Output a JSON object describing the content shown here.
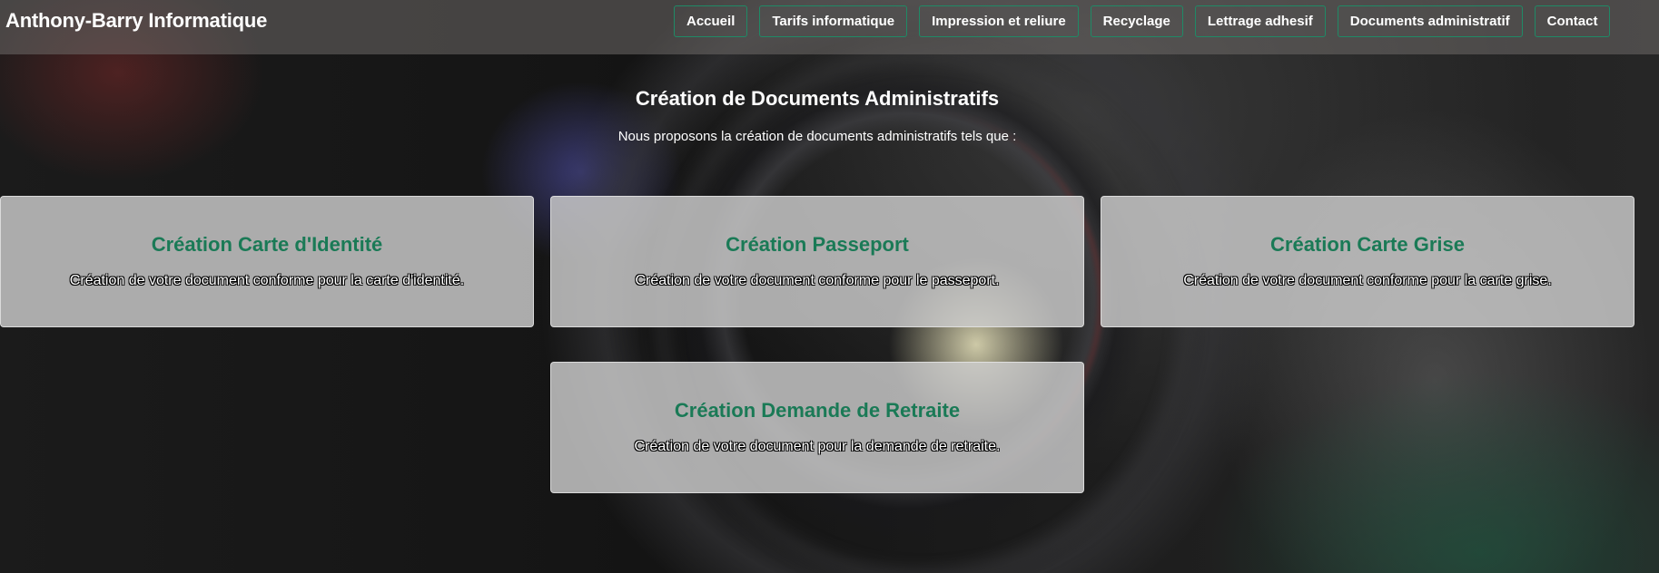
{
  "header": {
    "brand": "Anthony-Barry Informatique",
    "nav": [
      {
        "label": "Accueil"
      },
      {
        "label": "Tarifs informatique"
      },
      {
        "label": "Impression et reliure"
      },
      {
        "label": "Recyclage"
      },
      {
        "label": "Lettrage adhesif"
      },
      {
        "label": "Documents administratif"
      },
      {
        "label": "Contact"
      }
    ]
  },
  "main": {
    "title": "Création de Documents Administratifs",
    "intro": "Nous proposons la création de documents administratifs tels que :",
    "cards": [
      {
        "title": "Création Carte d'Identité",
        "text": "Création de votre document conforme pour la carte d'identité."
      },
      {
        "title": "Création Passeport",
        "text": "Création de votre document conforme pour le passeport."
      },
      {
        "title": "Création Carte Grise",
        "text": "Création de votre document conforme pour la carte grise."
      },
      {
        "title": "Création Demande de Retraite",
        "text": "Création de votre document pour la demande de retraite."
      }
    ]
  },
  "colors": {
    "accent": "#1a7a56",
    "nav_border": "#1f8a66",
    "header_bg": "#6e6968"
  }
}
